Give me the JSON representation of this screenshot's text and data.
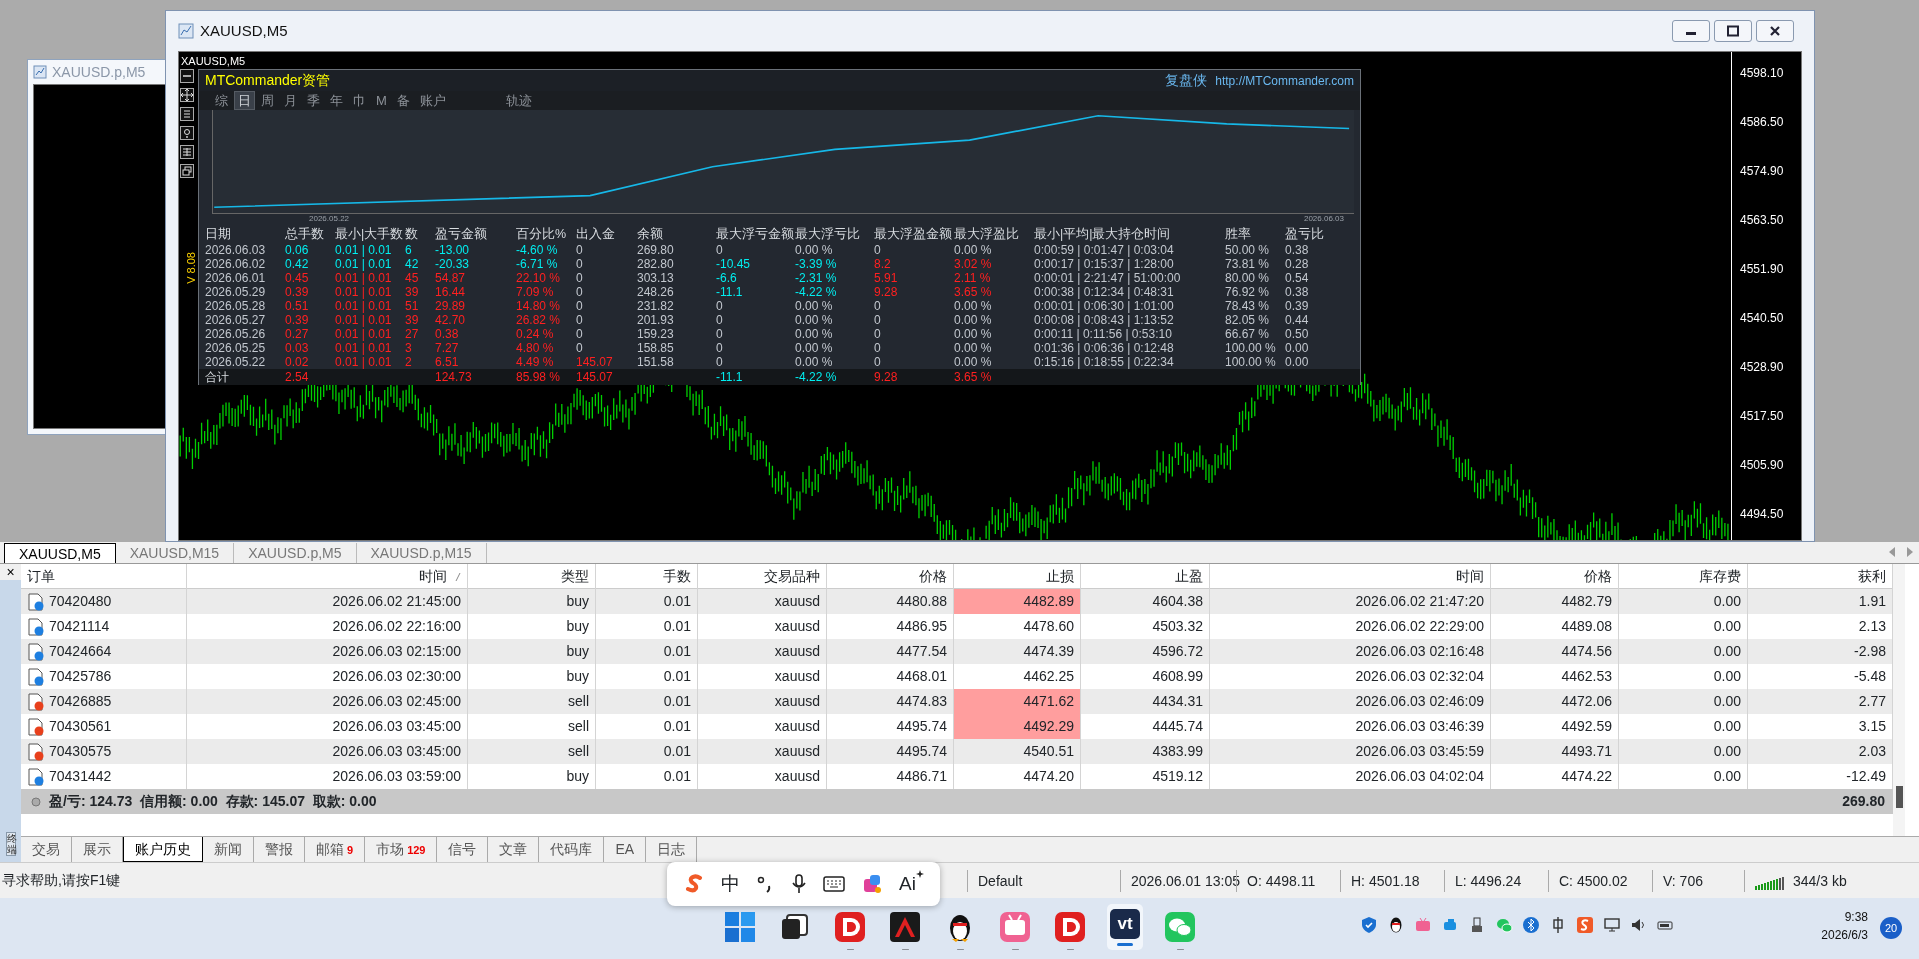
{
  "background_window": {
    "title": "XAUUSD.p,M5"
  },
  "window": {
    "title": "XAUUSD,M5",
    "chart_label": "XAUUSD,M5",
    "price_axis": [
      "4598.10",
      "4586.50",
      "4574.90",
      "4563.50",
      "4551.90",
      "4540.50",
      "4528.90",
      "4517.50",
      "4505.90",
      "4494.50"
    ]
  },
  "panel": {
    "title": "MTCommander资管",
    "brand": "复盘侠",
    "url": "http://MTCommander.com",
    "version": "V 8.08",
    "tabs": [
      {
        "label": "综",
        "selected": false
      },
      {
        "label": "日",
        "selected": true
      },
      {
        "label": "周",
        "selected": false
      },
      {
        "label": "月",
        "selected": false
      },
      {
        "label": "季",
        "selected": false
      },
      {
        "label": "年",
        "selected": false
      },
      {
        "label": "巾",
        "selected": false
      },
      {
        "label": "M",
        "selected": false
      },
      {
        "label": "备",
        "selected": false
      },
      {
        "label": "账户",
        "selected": false
      }
    ],
    "trail_tab": "轨迹",
    "equity_dates": [
      "2026.05.22",
      "2026.06.03"
    ],
    "columns": [
      "日期",
      "总手数",
      "最小|大手数",
      "数",
      "盈亏金额",
      "百分比%",
      "出入金",
      "余额",
      "最大浮亏金额",
      "最大浮亏比",
      "最大浮盈金额",
      "最大浮盈比",
      "最小|平均|最大持仓时间",
      "胜率",
      "盈亏比"
    ],
    "rows": [
      {
        "cells": [
          {
            "text": "2026.06.03",
            "color": "#c3c8cf"
          },
          {
            "text": "0.06",
            "color": "#00eef0"
          },
          {
            "text": "0.01 | 0.01",
            "color": "#00eef0"
          },
          {
            "text": "6",
            "color": "#00eef0"
          },
          {
            "text": "-13.00",
            "color": "#00eef0"
          },
          {
            "text": "-4.60 %",
            "color": "#00eef0"
          },
          {
            "text": "0",
            "color": "#c3c8cf"
          },
          {
            "text": "269.80",
            "color": "#c3c8cf"
          },
          {
            "text": "0",
            "color": "#c3c8cf"
          },
          {
            "text": "0.00 %",
            "color": "#c3c8cf"
          },
          {
            "text": "0",
            "color": "#c3c8cf"
          },
          {
            "text": "0.00 %",
            "color": "#c3c8cf"
          },
          {
            "text": "0:00:59 | 0:01:47 | 0:03:04",
            "color": "#c3c8cf"
          },
          {
            "text": "50.00 %",
            "color": "#c3c8cf"
          },
          {
            "text": "0.38",
            "color": "#c3c8cf"
          }
        ]
      },
      {
        "cells": [
          {
            "text": "2026.06.02",
            "color": "#c3c8cf"
          },
          {
            "text": "0.42",
            "color": "#00eef0"
          },
          {
            "text": "0.01 | 0.01",
            "color": "#00eef0"
          },
          {
            "text": "42",
            "color": "#00eef0"
          },
          {
            "text": "-20.33",
            "color": "#00eef0"
          },
          {
            "text": "-6.71 %",
            "color": "#00eef0"
          },
          {
            "text": "0",
            "color": "#c3c8cf"
          },
          {
            "text": "282.80",
            "color": "#c3c8cf"
          },
          {
            "text": "-10.45",
            "color": "#00eef0"
          },
          {
            "text": "-3.39 %",
            "color": "#00eef0"
          },
          {
            "text": "8.2",
            "color": "#ff2020"
          },
          {
            "text": "3.02 %",
            "color": "#ff2020"
          },
          {
            "text": "0:00:17 | 0:15:37 | 1:28:00",
            "color": "#c3c8cf"
          },
          {
            "text": "73.81 %",
            "color": "#c3c8cf"
          },
          {
            "text": "0.28",
            "color": "#c3c8cf"
          }
        ]
      },
      {
        "cells": [
          {
            "text": "2026.06.01",
            "color": "#c3c8cf"
          },
          {
            "text": "0.45",
            "color": "#ff2020"
          },
          {
            "text": "0.01 | 0.01",
            "color": "#ff2020"
          },
          {
            "text": "45",
            "color": "#ff2020"
          },
          {
            "text": "54.87",
            "color": "#ff2020"
          },
          {
            "text": "22.10 %",
            "color": "#ff2020"
          },
          {
            "text": "0",
            "color": "#c3c8cf"
          },
          {
            "text": "303.13",
            "color": "#c3c8cf"
          },
          {
            "text": "-6.6",
            "color": "#00eef0"
          },
          {
            "text": "-2.31 %",
            "color": "#00eef0"
          },
          {
            "text": "5.91",
            "color": "#ff2020"
          },
          {
            "text": "2.11 %",
            "color": "#ff2020"
          },
          {
            "text": "0:00:01 | 2:21:47 | 51:00:00",
            "color": "#c3c8cf"
          },
          {
            "text": "80.00 %",
            "color": "#c3c8cf"
          },
          {
            "text": "0.54",
            "color": "#c3c8cf"
          }
        ]
      },
      {
        "cells": [
          {
            "text": "2026.05.29",
            "color": "#c3c8cf"
          },
          {
            "text": "0.39",
            "color": "#ff2020"
          },
          {
            "text": "0.01 | 0.01",
            "color": "#ff2020"
          },
          {
            "text": "39",
            "color": "#ff2020"
          },
          {
            "text": "16.44",
            "color": "#ff2020"
          },
          {
            "text": "7.09 %",
            "color": "#ff2020"
          },
          {
            "text": "0",
            "color": "#c3c8cf"
          },
          {
            "text": "248.26",
            "color": "#c3c8cf"
          },
          {
            "text": "-11.1",
            "color": "#00eef0"
          },
          {
            "text": "-4.22 %",
            "color": "#00eef0"
          },
          {
            "text": "9.28",
            "color": "#ff2020"
          },
          {
            "text": "3.65 %",
            "color": "#ff2020"
          },
          {
            "text": "0:00:38 | 0:12:34 | 0:48:31",
            "color": "#c3c8cf"
          },
          {
            "text": "76.92 %",
            "color": "#c3c8cf"
          },
          {
            "text": "0.38",
            "color": "#c3c8cf"
          }
        ]
      },
      {
        "cells": [
          {
            "text": "2026.05.28",
            "color": "#c3c8cf"
          },
          {
            "text": "0.51",
            "color": "#ff2020"
          },
          {
            "text": "0.01 | 0.01",
            "color": "#ff2020"
          },
          {
            "text": "51",
            "color": "#ff2020"
          },
          {
            "text": "29.89",
            "color": "#ff2020"
          },
          {
            "text": "14.80 %",
            "color": "#ff2020"
          },
          {
            "text": "0",
            "color": "#c3c8cf"
          },
          {
            "text": "231.82",
            "color": "#c3c8cf"
          },
          {
            "text": "0",
            "color": "#c3c8cf"
          },
          {
            "text": "0.00 %",
            "color": "#c3c8cf"
          },
          {
            "text": "0",
            "color": "#c3c8cf"
          },
          {
            "text": "0.00 %",
            "color": "#c3c8cf"
          },
          {
            "text": "0:00:01 | 0:06:30 | 1:01:00",
            "color": "#c3c8cf"
          },
          {
            "text": "78.43 %",
            "color": "#c3c8cf"
          },
          {
            "text": "0.39",
            "color": "#c3c8cf"
          }
        ]
      },
      {
        "cells": [
          {
            "text": "2026.05.27",
            "color": "#c3c8cf"
          },
          {
            "text": "0.39",
            "color": "#ff2020"
          },
          {
            "text": "0.01 | 0.01",
            "color": "#ff2020"
          },
          {
            "text": "39",
            "color": "#ff2020"
          },
          {
            "text": "42.70",
            "color": "#ff2020"
          },
          {
            "text": "26.82 %",
            "color": "#ff2020"
          },
          {
            "text": "0",
            "color": "#c3c8cf"
          },
          {
            "text": "201.93",
            "color": "#c3c8cf"
          },
          {
            "text": "0",
            "color": "#c3c8cf"
          },
          {
            "text": "0.00 %",
            "color": "#c3c8cf"
          },
          {
            "text": "0",
            "color": "#c3c8cf"
          },
          {
            "text": "0.00 %",
            "color": "#c3c8cf"
          },
          {
            "text": "0:00:08 | 0:08:43 | 1:13:52",
            "color": "#c3c8cf"
          },
          {
            "text": "82.05 %",
            "color": "#c3c8cf"
          },
          {
            "text": "0.44",
            "color": "#c3c8cf"
          }
        ]
      },
      {
        "cells": [
          {
            "text": "2026.05.26",
            "color": "#c3c8cf"
          },
          {
            "text": "0.27",
            "color": "#ff2020"
          },
          {
            "text": "0.01 | 0.01",
            "color": "#ff2020"
          },
          {
            "text": "27",
            "color": "#ff2020"
          },
          {
            "text": "0.38",
            "color": "#ff2020"
          },
          {
            "text": "0.24 %",
            "color": "#ff2020"
          },
          {
            "text": "0",
            "color": "#c3c8cf"
          },
          {
            "text": "159.23",
            "color": "#c3c8cf"
          },
          {
            "text": "0",
            "color": "#c3c8cf"
          },
          {
            "text": "0.00 %",
            "color": "#c3c8cf"
          },
          {
            "text": "0",
            "color": "#c3c8cf"
          },
          {
            "text": "0.00 %",
            "color": "#c3c8cf"
          },
          {
            "text": "0:00:11 | 0:11:56 | 0:53:10",
            "color": "#c3c8cf"
          },
          {
            "text": "66.67 %",
            "color": "#c3c8cf"
          },
          {
            "text": "0.50",
            "color": "#c3c8cf"
          }
        ]
      },
      {
        "cells": [
          {
            "text": "2026.05.25",
            "color": "#c3c8cf"
          },
          {
            "text": "0.03",
            "color": "#ff2020"
          },
          {
            "text": "0.01 | 0.01",
            "color": "#ff2020"
          },
          {
            "text": "3",
            "color": "#ff2020"
          },
          {
            "text": "7.27",
            "color": "#ff2020"
          },
          {
            "text": "4.80 %",
            "color": "#ff2020"
          },
          {
            "text": "0",
            "color": "#c3c8cf"
          },
          {
            "text": "158.85",
            "color": "#c3c8cf"
          },
          {
            "text": "0",
            "color": "#c3c8cf"
          },
          {
            "text": "0.00 %",
            "color": "#c3c8cf"
          },
          {
            "text": "0",
            "color": "#c3c8cf"
          },
          {
            "text": "0.00 %",
            "color": "#c3c8cf"
          },
          {
            "text": "0:01:36 | 0:06:36 | 0:12:48",
            "color": "#c3c8cf"
          },
          {
            "text": "100.00 %",
            "color": "#c3c8cf"
          },
          {
            "text": "0.00",
            "color": "#c3c8cf"
          }
        ]
      },
      {
        "cells": [
          {
            "text": "2026.05.22",
            "color": "#c3c8cf"
          },
          {
            "text": "0.02",
            "color": "#ff2020"
          },
          {
            "text": "0.01 | 0.01",
            "color": "#ff2020"
          },
          {
            "text": "2",
            "color": "#ff2020"
          },
          {
            "text": "6.51",
            "color": "#ff2020"
          },
          {
            "text": "4.49 %",
            "color": "#ff2020"
          },
          {
            "text": "145.07",
            "color": "#ff2020"
          },
          {
            "text": "151.58",
            "color": "#c3c8cf"
          },
          {
            "text": "0",
            "color": "#c3c8cf"
          },
          {
            "text": "0.00 %",
            "color": "#c3c8cf"
          },
          {
            "text": "0",
            "color": "#c3c8cf"
          },
          {
            "text": "0.00 %",
            "color": "#c3c8cf"
          },
          {
            "text": "0:15:16 | 0:18:55 | 0:22:34",
            "color": "#c3c8cf"
          },
          {
            "text": "100.00 %",
            "color": "#c3c8cf"
          },
          {
            "text": "0.00",
            "color": "#c3c8cf"
          }
        ]
      }
    ],
    "total": {
      "cells": [
        {
          "text": "合计"
        },
        {
          "text": "2.54",
          "color": "#ff2020"
        },
        null,
        null,
        {
          "text": "124.73",
          "color": "#ff2020"
        },
        {
          "text": "85.98 %",
          "color": "#ff2020"
        },
        {
          "text": "145.07",
          "color": "#ff2020"
        },
        null,
        {
          "text": "-11.1",
          "color": "#00eef0"
        },
        {
          "text": "-4.22 %",
          "color": "#00eef0"
        },
        {
          "text": "9.28",
          "color": "#ff2020"
        },
        {
          "text": "3.65 %",
          "color": "#ff2020"
        },
        null,
        null,
        null
      ]
    }
  },
  "chart_tabs": [
    {
      "label": "XAUUSD,M5",
      "selected": true
    },
    {
      "label": "XAUUSD,M15",
      "selected": false
    },
    {
      "label": "XAUUSD.p,M5",
      "selected": false
    },
    {
      "label": "XAUUSD.p,M15",
      "selected": false
    }
  ],
  "orders": {
    "columns": [
      {
        "label": "订单",
        "sorted": false
      },
      {
        "label": "时间",
        "sorted": true
      },
      {
        "label": "类型",
        "sorted": false
      },
      {
        "label": "手数",
        "sorted": false
      },
      {
        "label": "交易品种",
        "sorted": false
      },
      {
        "label": "价格",
        "sorted": false
      },
      {
        "label": "止损",
        "sorted": false
      },
      {
        "label": "止盈",
        "sorted": false
      },
      {
        "label": "时间",
        "sorted": false
      },
      {
        "label": "价格",
        "sorted": false
      },
      {
        "label": "库存费",
        "sorted": false
      },
      {
        "label": "获利",
        "sorted": false
      }
    ],
    "rows": [
      {
        "kind": "buy",
        "sl_hit": true,
        "cells": [
          "70420480",
          "2026.06.02 21:45:00",
          "buy",
          "0.01",
          "xauusd",
          "4480.88",
          "4482.89",
          "4604.38",
          "2026.06.02 21:47:20",
          "4482.79",
          "0.00",
          "1.91"
        ]
      },
      {
        "kind": "buy",
        "sl_hit": false,
        "cells": [
          "70421114",
          "2026.06.02 22:16:00",
          "buy",
          "0.01",
          "xauusd",
          "4486.95",
          "4478.60",
          "4503.32",
          "2026.06.02 22:29:00",
          "4489.08",
          "0.00",
          "2.13"
        ]
      },
      {
        "kind": "buy",
        "sl_hit": false,
        "cells": [
          "70424664",
          "2026.06.03 02:15:00",
          "buy",
          "0.01",
          "xauusd",
          "4477.54",
          "4474.39",
          "4596.72",
          "2026.06.03 02:16:48",
          "4474.56",
          "0.00",
          "-2.98"
        ]
      },
      {
        "kind": "buy",
        "sl_hit": false,
        "cells": [
          "70425786",
          "2026.06.03 02:30:00",
          "buy",
          "0.01",
          "xauusd",
          "4468.01",
          "4462.25",
          "4608.99",
          "2026.06.03 02:32:04",
          "4462.53",
          "0.00",
          "-5.48"
        ]
      },
      {
        "kind": "sell",
        "sl_hit": true,
        "cells": [
          "70426885",
          "2026.06.03 02:45:00",
          "sell",
          "0.01",
          "xauusd",
          "4474.83",
          "4471.62",
          "4434.31",
          "2026.06.03 02:46:09",
          "4472.06",
          "0.00",
          "2.77"
        ]
      },
      {
        "kind": "sell",
        "sl_hit": true,
        "cells": [
          "70430561",
          "2026.06.03 03:45:00",
          "sell",
          "0.01",
          "xauusd",
          "4495.74",
          "4492.29",
          "4445.74",
          "2026.06.03 03:46:39",
          "4492.59",
          "0.00",
          "3.15"
        ]
      },
      {
        "kind": "sell",
        "sl_hit": false,
        "cells": [
          "70430575",
          "2026.06.03 03:45:00",
          "sell",
          "0.01",
          "xauusd",
          "4495.74",
          "4540.51",
          "4383.99",
          "2026.06.03 03:45:59",
          "4493.71",
          "0.00",
          "2.03"
        ]
      },
      {
        "kind": "buy",
        "sl_hit": false,
        "cells": [
          "70431442",
          "2026.06.03 03:59:00",
          "buy",
          "0.01",
          "xauusd",
          "4486.71",
          "4474.20",
          "4519.12",
          "2026.06.03 04:02:04",
          "4474.22",
          "0.00",
          "-12.49"
        ]
      }
    ],
    "summary": "盈/亏: 124.73  信用额: 0.00  存款: 145.07  取款: 0.00",
    "balance": "269.80"
  },
  "terminal": {
    "close": "×",
    "label": "终端",
    "tabs": [
      {
        "label": "交易",
        "selected": false
      },
      {
        "label": "展示",
        "selected": false
      },
      {
        "label": "账户历史",
        "selected": true
      },
      {
        "label": "新闻",
        "selected": false
      },
      {
        "label": "警报",
        "selected": false
      },
      {
        "label": "邮箱",
        "badge": "9",
        "selected": false
      },
      {
        "label": "市场",
        "badge": "129",
        "selected": false
      },
      {
        "label": "信号",
        "selected": false
      },
      {
        "label": "文章",
        "selected": false
      },
      {
        "label": "代码库",
        "selected": false
      },
      {
        "label": "EA",
        "selected": false
      },
      {
        "label": "日志",
        "selected": false
      }
    ]
  },
  "status_bar": {
    "help": "寻求帮助,请按F1键",
    "profile": "Default",
    "time": "2026.06.01 13:05",
    "open": "O: 4498.11",
    "high": "H: 4501.18",
    "low": "L: 4496.24",
    "close": "C: 4500.02",
    "volume": "V: 706",
    "traffic": "344/3 kb"
  },
  "ime_toolbar": {
    "mode": "中",
    "ai": "Ai"
  },
  "taskbar": {
    "apps": [
      {
        "kind": "start",
        "running": false,
        "active": false
      },
      {
        "kind": "taskview",
        "running": false,
        "active": false
      },
      {
        "kind": "red-d",
        "running": true,
        "active": false
      },
      {
        "kind": "red-a",
        "running": true,
        "active": false
      },
      {
        "kind": "penguin",
        "running": true,
        "active": false
      },
      {
        "kind": "pink",
        "running": true,
        "active": false
      },
      {
        "kind": "red-d",
        "running": true,
        "active": false
      },
      {
        "kind": "vt",
        "label": "vt",
        "running": true,
        "active": true
      },
      {
        "kind": "chat",
        "running": true,
        "active": false
      }
    ],
    "time": "9:38",
    "date": "2026/6/3",
    "notifications": "20"
  }
}
